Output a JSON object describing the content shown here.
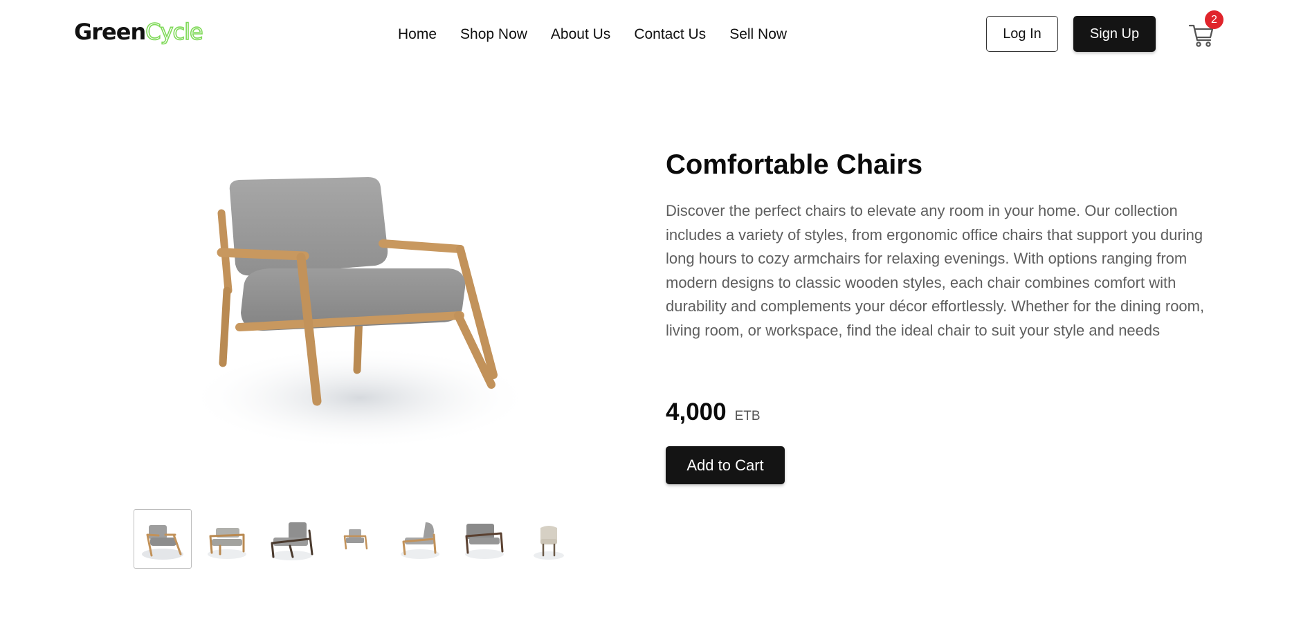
{
  "brand": {
    "part1": "Green",
    "part2": "Cycle",
    "accent_color": "#7ed957"
  },
  "nav": {
    "items": [
      {
        "label": "Home"
      },
      {
        "label": "Shop Now"
      },
      {
        "label": "About Us"
      },
      {
        "label": "Contact Us"
      },
      {
        "label": "Sell Now"
      }
    ]
  },
  "auth": {
    "login_label": "Log In",
    "signup_label": "Sign Up"
  },
  "cart": {
    "icon": "cart-icon",
    "count": "2",
    "badge_color": "#e0242b"
  },
  "product": {
    "title": "Comfortable Chairs",
    "description": "Discover the perfect chairs to elevate any room in your home. Our collection includes a variety of styles, from ergonomic office chairs that support you during long hours to cozy armchairs for relaxing evenings. With options ranging from modern designs to classic wooden styles, each chair combines comfort with durability and complements your décor effortlessly. Whether for the dining room, living room, or workspace, find the ideal chair to suit your style and needs",
    "price": "4,000",
    "currency": "ETB",
    "add_to_cart_label": "Add to Cart",
    "thumbnails": [
      {
        "name": "chair-thumb-1",
        "active": true
      },
      {
        "name": "chair-thumb-2",
        "active": false
      },
      {
        "name": "chair-thumb-3",
        "active": false
      },
      {
        "name": "chair-thumb-4",
        "active": false
      },
      {
        "name": "chair-thumb-5",
        "active": false
      },
      {
        "name": "chair-thumb-6",
        "active": false
      },
      {
        "name": "chair-thumb-7",
        "active": false
      }
    ]
  }
}
